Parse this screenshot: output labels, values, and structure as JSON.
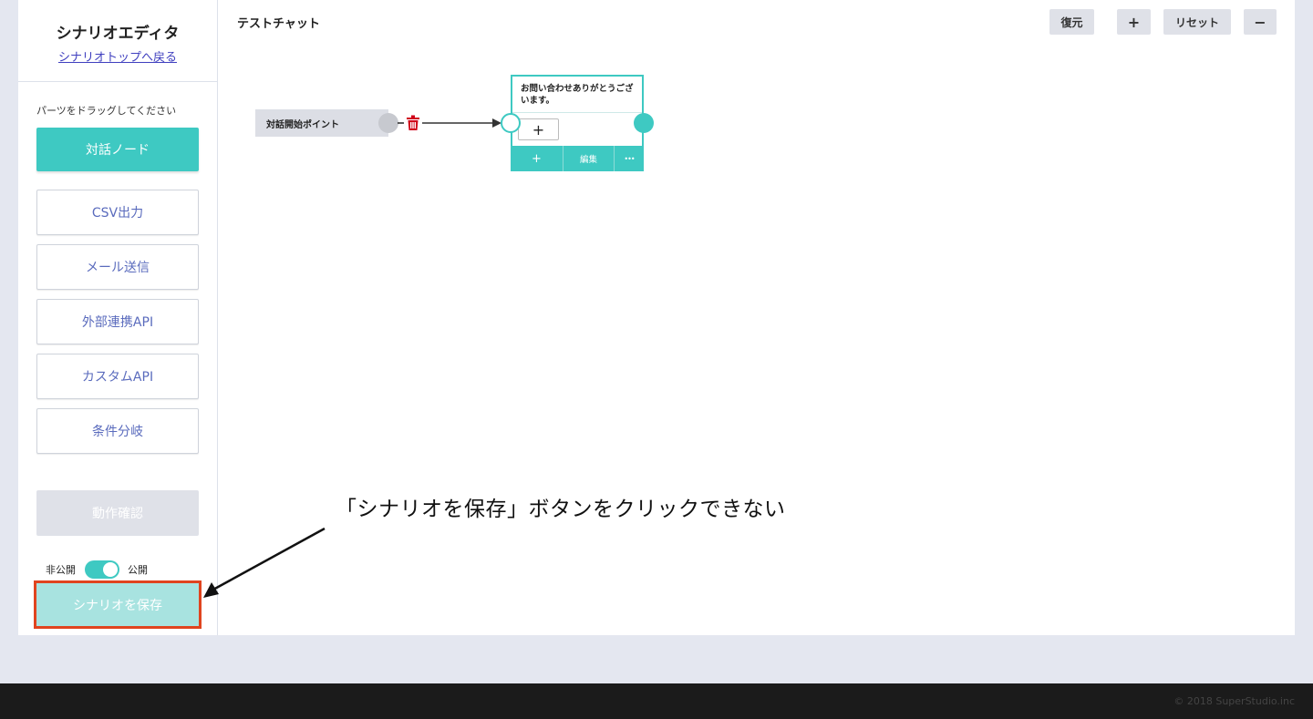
{
  "sidebar": {
    "title": "シナリオエディタ",
    "back_link": "シナリオトップへ戻る",
    "hint": "パーツをドラッグしてください",
    "parts": [
      "対話ノード",
      "CSV出力",
      "メール送信",
      "外部連携API",
      "カスタムAPI",
      "条件分岐"
    ],
    "test_button": "動作確認",
    "toggle": {
      "off_label": "非公開",
      "on_label": "公開",
      "state": "on"
    },
    "save_button": "シナリオを保存"
  },
  "canvas": {
    "title": "テストチャット",
    "toolbar": {
      "restore": "復元",
      "zoom_in": "+",
      "reset": "リセット",
      "zoom_out": "−"
    },
    "start_node": {
      "label": "対話開始ポイント"
    },
    "dialog_node": {
      "text": "お問い合わせありがとうございます。",
      "add_button": "+",
      "footer": {
        "add": "+",
        "edit": "編集",
        "more": "•••"
      }
    }
  },
  "annotation": {
    "text": "「シナリオを保存」ボタンをクリックできない"
  },
  "footer": {
    "copyright": "© 2018 SuperStudio.inc"
  },
  "colors": {
    "accent": "#3ec9c2",
    "highlight": "#e0441f",
    "trash": "#d0021b",
    "page_bg": "#e4e7f0",
    "footer_bg": "#1b1b1b"
  }
}
